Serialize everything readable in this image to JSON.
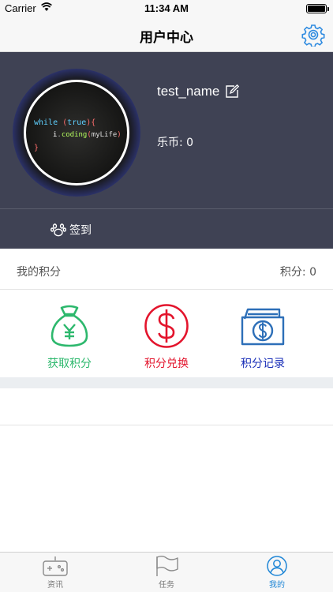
{
  "status_bar": {
    "carrier": "Carrier",
    "time": "11:34 AM",
    "battery_level": 1.0
  },
  "nav": {
    "title": "用户中心",
    "settings_icon": "gear-icon"
  },
  "profile": {
    "avatar_icon": "code-avatar-image",
    "username": "test_name",
    "edit_icon": "edit-icon",
    "coins_text": "乐币: 0",
    "checkin_label": "签到",
    "checkin_icon": "paw-icon",
    "background_color": "#3f4254"
  },
  "points": {
    "label": "我的积分",
    "value_text": "积分: 0"
  },
  "actions": [
    {
      "label": "获取积分",
      "icon": "money-bag-icon",
      "color": "#2db86d"
    },
    {
      "label": "积分兑换",
      "icon": "dollar-circle-icon",
      "color": "#e3142c"
    },
    {
      "label": "积分记录",
      "icon": "cash-stack-icon",
      "color": "#1a2fb8"
    }
  ],
  "tab_bar": {
    "tabs": [
      {
        "label": "资讯",
        "icon": "gamepad-icon",
        "active": false
      },
      {
        "label": "任务",
        "icon": "flag-icon",
        "active": false
      },
      {
        "label": "我的",
        "icon": "user-circle-icon",
        "active": true
      }
    ],
    "active_color": "#1f86d6"
  }
}
